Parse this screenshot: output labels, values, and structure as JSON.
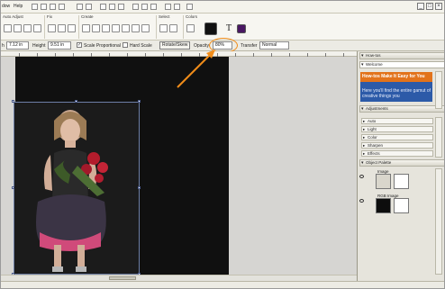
{
  "menubar": {
    "items": [
      "dow",
      "Help"
    ],
    "window_controls": [
      "_",
      "□",
      "×"
    ]
  },
  "ribbon": {
    "groups": [
      "Auto Adjust",
      "Fix",
      "Create",
      "Select",
      "Colors"
    ],
    "text_tool_glyph": "T",
    "colors": {
      "foreground": "#111111",
      "swatch": "#4a1763"
    }
  },
  "options": {
    "width_label": "h",
    "width_value": "7.12 in",
    "height_label": "Height",
    "height_value": "9.51 in",
    "scale_proportional": {
      "label": "Scale Proportional",
      "checked": true
    },
    "hard_scale": {
      "label": "Hard Scale",
      "checked": false
    },
    "rotate_skew_label": "Rotate/Skew",
    "opacity_label": "Opacity",
    "opacity_value": "80%",
    "transfer_label": "Transfer",
    "transfer_value": "Normal"
  },
  "panel": {
    "howto": {
      "title": "How-tos",
      "section": "Welcome",
      "headline": "How-tos Make It Easy for You",
      "body": "Here you'll find the entire gamut of creative things you"
    },
    "adjustments": {
      "title": "Adjustments",
      "items": [
        "Auto",
        "Light",
        "Color",
        "Sharpen",
        "Effects"
      ]
    },
    "object_palette": {
      "title": "Object Palette",
      "layers": [
        {
          "name": "Image"
        },
        {
          "name": "RGB Image"
        }
      ]
    }
  },
  "annotation": {
    "color": "#f08c1a"
  }
}
